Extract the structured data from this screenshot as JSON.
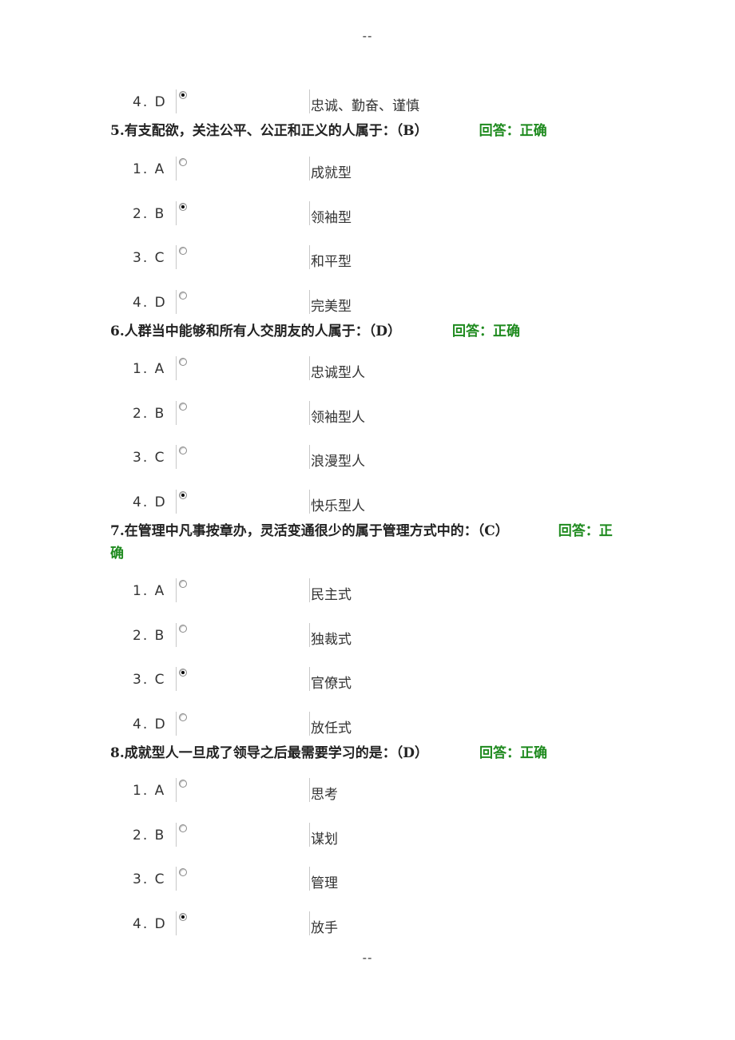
{
  "page_marker_top": "--",
  "page_marker_bottom": "--",
  "q4_tail": {
    "options": [
      {
        "label": "4. D",
        "text": "忠诚、勤奋、谨慎",
        "selected": true
      }
    ]
  },
  "questions": [
    {
      "title": "5.有支配欲，关注公平、公正和正义的人属于：（B）",
      "result": "回答：正确",
      "options": [
        {
          "label": "1. A",
          "text": "成就型",
          "selected": false
        },
        {
          "label": "2. B",
          "text": "领袖型",
          "selected": true
        },
        {
          "label": "3. C",
          "text": "和平型",
          "selected": false
        },
        {
          "label": "4. D",
          "text": "完美型",
          "selected": false
        }
      ]
    },
    {
      "title": "6.人群当中能够和所有人交朋友的人属于：（D）",
      "result": "回答：正确",
      "options": [
        {
          "label": "1. A",
          "text": "忠诚型人",
          "selected": false
        },
        {
          "label": "2. B",
          "text": "领袖型人",
          "selected": false
        },
        {
          "label": "3. C",
          "text": "浪漫型人",
          "selected": false
        },
        {
          "label": "4. D",
          "text": "快乐型人",
          "selected": true
        }
      ]
    },
    {
      "title": "7.在管理中凡事按章办，灵活变通很少的属于管理方式中的：（C）",
      "result": "回答：正确",
      "options": [
        {
          "label": "1. A",
          "text": "民主式",
          "selected": false
        },
        {
          "label": "2. B",
          "text": "独裁式",
          "selected": false
        },
        {
          "label": "3. C",
          "text": "官僚式",
          "selected": true
        },
        {
          "label": "4. D",
          "text": "放任式",
          "selected": false
        }
      ]
    },
    {
      "title": "8.成就型人一旦成了领导之后最需要学习的是：（D）",
      "result": "回答：正确",
      "options": [
        {
          "label": "1. A",
          "text": "思考",
          "selected": false
        },
        {
          "label": "2. B",
          "text": "谋划",
          "selected": false
        },
        {
          "label": "3. C",
          "text": "管理",
          "selected": false
        },
        {
          "label": "4. D",
          "text": "放手",
          "selected": true
        }
      ]
    }
  ]
}
